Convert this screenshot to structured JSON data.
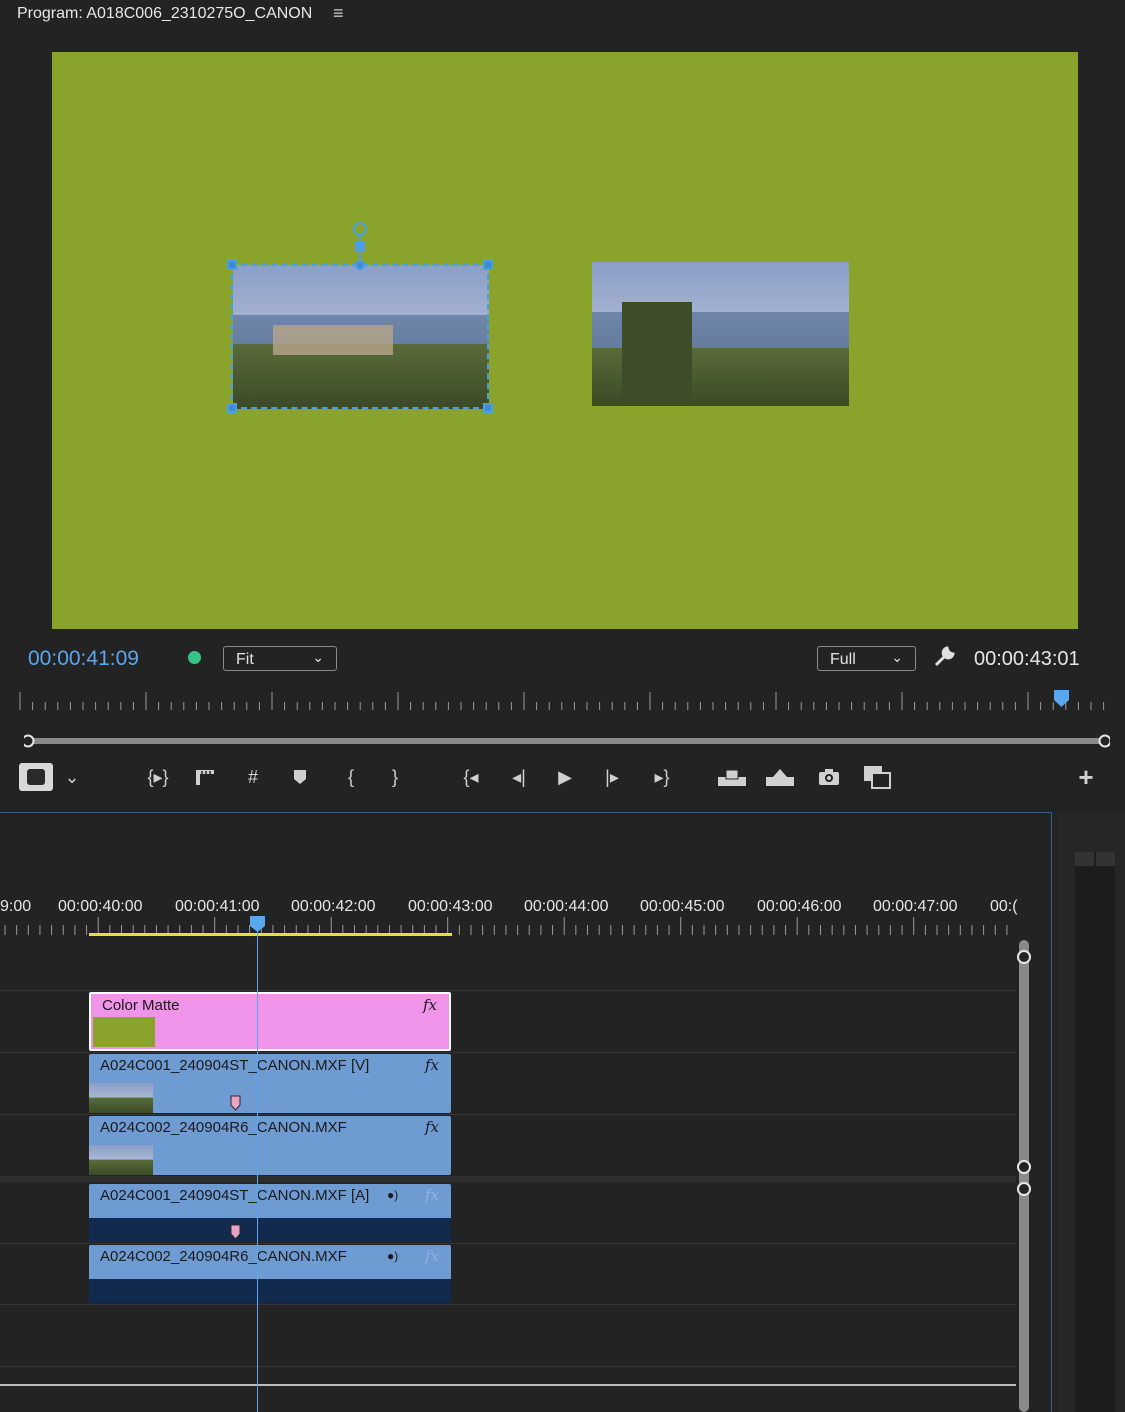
{
  "program": {
    "title": "Program: A018C006_2310275O_CANON",
    "timecode_current": "00:00:41:09",
    "fit_label": "Fit",
    "quality_label": "Full",
    "timecode_duration": "00:00:43:01"
  },
  "viewer": {
    "background_color": "#8aa32b"
  },
  "timeline": {
    "time_labels": [
      "9:00",
      "00:00:40:00",
      "00:00:41:00",
      "00:00:42:00",
      "00:00:43:00",
      "00:00:44:00",
      "00:00:45:00",
      "00:00:46:00",
      "00:00:47:00",
      "00:("
    ],
    "clips": {
      "color_matte": "Color Matte",
      "v2": "A024C001_240904ST_CANON.MXF [V]",
      "v1": "A024C002_240904R6_CANON.MXF",
      "a1": "A024C001_240904ST_CANON.MXF [A]",
      "a2": "A024C002_240904R6_CANON.MXF",
      "fx_label": "fx"
    }
  },
  "colors": {
    "accent": "#5aa7ef",
    "color_matte_clip": "#ef94e8",
    "video_clip": "#6f9bd3",
    "in_out_bar": "#e8e03a"
  },
  "icons": [
    "hamburger-menu-icon",
    "wrench-icon",
    "safe-margins-icon",
    "add-marker-icon",
    "mark-in-icon",
    "mark-out-icon",
    "go-to-in-icon",
    "step-back-icon",
    "play-icon",
    "step-forward-icon",
    "go-to-out-icon",
    "lift-icon",
    "extract-icon",
    "export-frame-icon",
    "comparison-view-icon",
    "add-button-icon"
  ]
}
